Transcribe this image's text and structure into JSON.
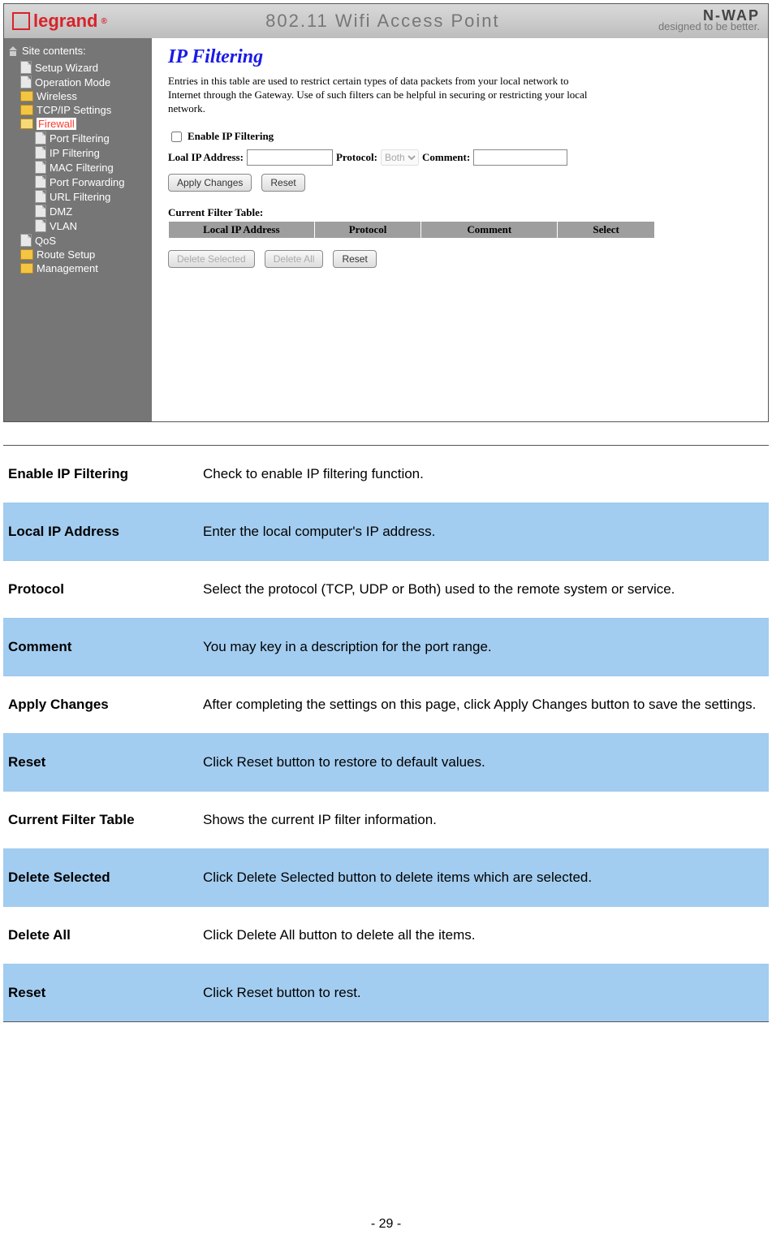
{
  "top": {
    "logo_text": "legrand",
    "center_title": "802.11 Wifi Access Point",
    "brand_top": "N-WAP",
    "brand_sub": "designed to be better."
  },
  "sidebar": {
    "title": "Site contents:",
    "setup_wizard": "Setup Wizard",
    "operation_mode": "Operation Mode",
    "wireless": "Wireless",
    "tcpip": "TCP/IP Settings",
    "firewall": "Firewall",
    "port_filtering": "Port Filtering",
    "ip_filtering": "IP Filtering",
    "mac_filtering": "MAC Filtering",
    "port_forwarding": "Port Forwarding",
    "url_filtering": "URL Filtering",
    "dmz": "DMZ",
    "vlan": "VLAN",
    "qos": "QoS",
    "route_setup": "Route Setup",
    "management": "Management"
  },
  "content": {
    "heading": "IP Filtering",
    "intro": "Entries in this table are used to restrict certain types of data packets from your local network to Internet through the Gateway. Use of such filters can be helpful in securing or restricting your local network.",
    "enable_label": "Enable IP Filtering",
    "local_ip_label": "Loal IP Address:",
    "protocol_label": "Protocol:",
    "protocol_value": "Both",
    "comment_label": "Comment:",
    "btn_apply": "Apply Changes",
    "btn_reset": "Reset",
    "table_title": "Current Filter Table:",
    "th_local": "Local IP Address",
    "th_protocol": "Protocol",
    "th_comment": "Comment",
    "th_select": "Select",
    "btn_delete_selected": "Delete Selected",
    "btn_delete_all": "Delete All",
    "btn_reset2": "Reset"
  },
  "defs": [
    {
      "label": "Enable IP Filtering",
      "desc": "Check to enable IP filtering function.",
      "blue": false
    },
    {
      "label": "Local IP Address",
      "desc": "Enter the local computer's IP address.",
      "blue": true
    },
    {
      "label": "Protocol",
      "desc": "Select the protocol (TCP, UDP or Both) used to the remote system or service.",
      "blue": false
    },
    {
      "label": "Comment",
      "desc": "You may key in a description for the port range.",
      "blue": true
    },
    {
      "label": "Apply Changes",
      "desc": "After completing the settings on this page, click Apply Changes button to save the settings.",
      "blue": false
    },
    {
      "label": "Reset",
      "desc": "Click Reset button to restore to default values.",
      "blue": true
    },
    {
      "label": "Current Filter Table",
      "desc": "Shows the current IP filter information.",
      "blue": false
    },
    {
      "label": "Delete Selected",
      "desc": "Click Delete Selected button to delete items which are selected.",
      "blue": true
    },
    {
      "label": "Delete All",
      "desc": "Click Delete All button to delete all the items.",
      "blue": false
    },
    {
      "label": "Reset",
      "desc": "Click Reset button to rest.",
      "blue": true
    }
  ],
  "footer": "- 29 -"
}
